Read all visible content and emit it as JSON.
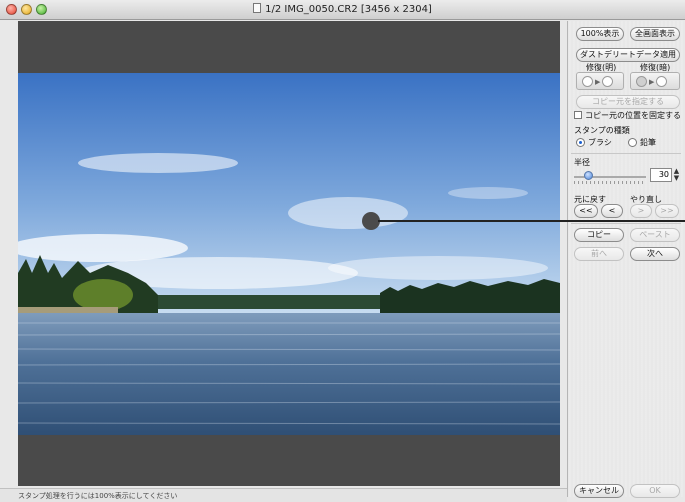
{
  "window": {
    "title": "1/2 IMG_0050.CR2 [3456 x 2304]",
    "close_icon": "close-icon",
    "minimize_icon": "minimize-icon",
    "zoom_icon": "zoom-icon"
  },
  "photo": {
    "description_icon": "landscape-photo",
    "colors": {
      "sky_top": "#3f78c8",
      "sky_bottom": "#bdd6ee",
      "water": "#4d6f94",
      "forest": "#1f3a22"
    }
  },
  "panel": {
    "view_100_label": "100%表示",
    "view_full_label": "全画面表示",
    "dust_delete_label": "ダストデリートデータ適用",
    "repair_dark_label": "修復(明)",
    "repair_light_label": "修復(暗)",
    "copy_source_label": "コピー元を指定する",
    "fix_position_label": "コピー元の位置を固定する",
    "stamp_type_label": "スタンプの種類",
    "brush_label": "ブラシ",
    "pencil_label": "鉛筆",
    "radius_label": "半径",
    "radius_value": "30",
    "radius_fraction": 0.2,
    "undo_label": "元に戻す",
    "redo_label": "やり直し",
    "undo_all": "<<",
    "undo_one": "<",
    "redo_one": ">",
    "redo_all": ">>",
    "copy_label": "コピー",
    "paste_label": "ペースト",
    "prev_label": "前へ",
    "next_label": "次へ",
    "cancel_label": "キャンセル",
    "ok_label": "OK"
  },
  "status": {
    "text": "スタンプ処理を行うには100%表示にしてください"
  }
}
